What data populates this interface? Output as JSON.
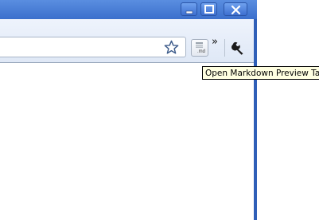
{
  "window": {
    "controls": {
      "minimize_icon": "minimize-icon",
      "maximize_icon": "maximize-icon",
      "close_icon": "close-icon"
    },
    "frame_color": "#2f5fb8"
  },
  "toolbar": {
    "omnibox_value": "",
    "star_icon": "star-icon",
    "extension_button_text": ".md",
    "overflow_chevron": "»",
    "wrench_icon": "wrench-icon"
  },
  "tooltip": {
    "text": "Open Markdown Preview Tab"
  }
}
